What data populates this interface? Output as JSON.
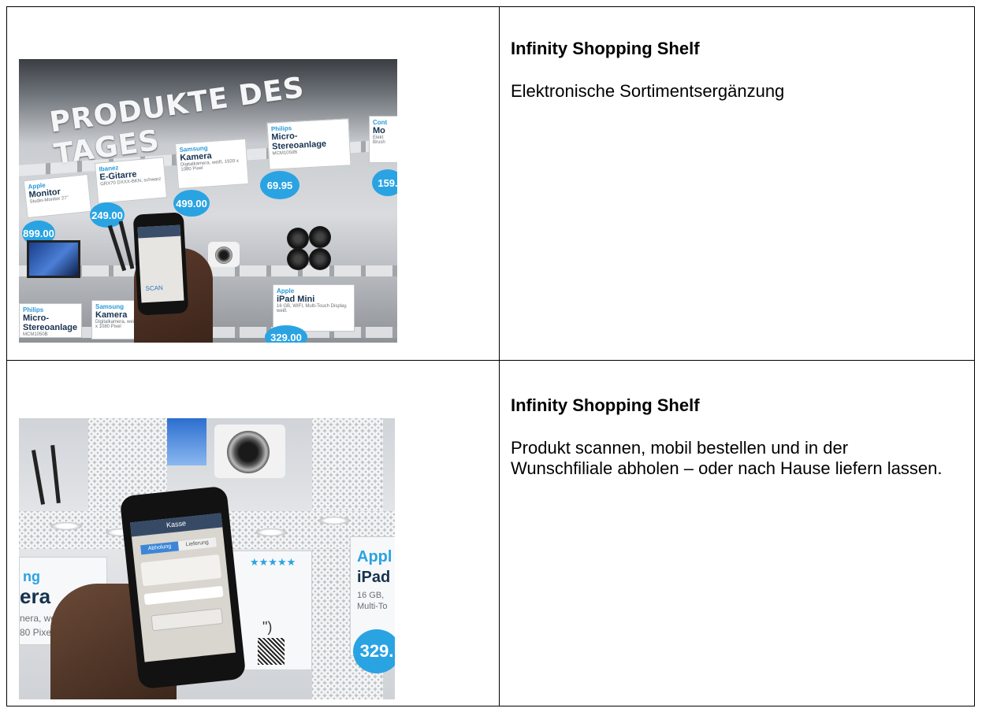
{
  "rows": [
    {
      "title": "Infinity Shopping Shelf",
      "text": "Elektronische Sortimentsergänzung",
      "photo": {
        "banner": "PRODUKTE DES TAGES",
        "cards": [
          {
            "brand": "Apple",
            "name": "Monitor",
            "desc": "Studio-Monitor 27\"",
            "price": "899.00"
          },
          {
            "brand": "Ibanez",
            "name": "E-Gitarre",
            "desc": "GRX70 DXXX-BKN, schwarz",
            "price": "249.00"
          },
          {
            "brand": "Samsung",
            "name": "Kamera",
            "desc": "Digitalkamera, weiß, 1920 x 1080 Pixel",
            "price": "499.00"
          },
          {
            "brand": "Philips",
            "name": "Micro-Stereoanlage",
            "desc": "MCM1050B",
            "price": "69.95"
          },
          {
            "brand": "Cont",
            "name": "Mo",
            "desc": "Elekt Brush",
            "price": "159."
          },
          {
            "brand": "Apple",
            "name": "iPad Mini",
            "desc": "16 GB, WIFI, Multi-Touch Display, weiß",
            "price": "329.00"
          },
          {
            "brand": "Philips",
            "name": "Micro-Stereoanlage",
            "desc": "MCM1050B",
            "price": ""
          },
          {
            "brand": "Samsung",
            "name": "Kamera",
            "desc": "Digitalkamera, weiß, 1920 x 1080 Pixel",
            "price": ""
          }
        ],
        "phone_screen_label": "SCAN"
      }
    },
    {
      "title": "Infinity Shopping Shelf",
      "text": "Produkt scannen, mobil bestellen und in der Wunschfiliale abholen – oder nach Hause liefern lassen.",
      "photo": {
        "left_card_lines": [
          "ng",
          "era",
          "nera, weiß,",
          "80 Pixel"
        ],
        "right_card_lines": [
          "Appl",
          "iPad",
          "16 GB,",
          "Multi-To"
        ],
        "price": "329.",
        "stars": "★★★★★",
        "phone_header": "Kasse",
        "phone_tabs": [
          "Abholung",
          "Lieferung"
        ]
      }
    }
  ]
}
